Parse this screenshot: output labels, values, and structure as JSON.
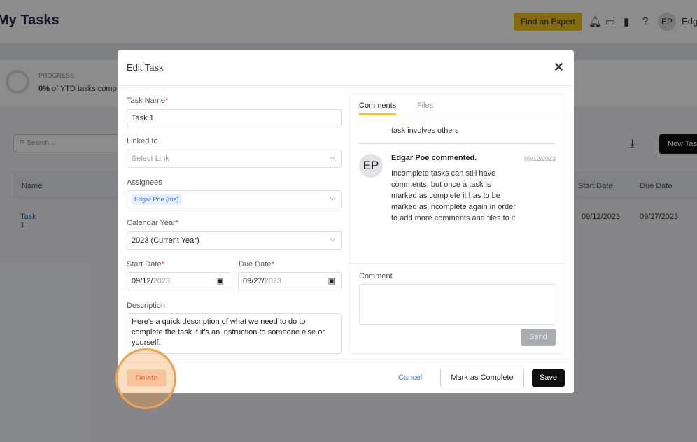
{
  "page": {
    "title": "My Tasks",
    "find_expert": "Find an Expert",
    "avatar": "EP",
    "user": "Edg",
    "progress_label": "PROGRESS",
    "progress_pct": "0%",
    "progress_text": "of YTD tasks comp",
    "search_placeholder": "Search...",
    "new_task": "New Tas",
    "columns": {
      "name": "Name",
      "start": "Start Date",
      "due": "Due Date"
    },
    "row": {
      "name": "Task 1",
      "start": "09/12/2023",
      "due": "09/27/2023"
    }
  },
  "modal": {
    "title": "Edit Task",
    "task_name_label": "Task Name",
    "task_name": "Task 1",
    "linked_label": "Linked to",
    "linked_placeholder": "Select Link",
    "assignees_label": "Assignees",
    "assignee": "Edgar Poe (me)",
    "year_label": "Calendar Year",
    "year": "2023 (Current Year)",
    "start_label": "Start Date",
    "start_md": "09/12/",
    "start_y": "2023",
    "due_label": "Due Date",
    "due_md": "09/27/",
    "due_y": "2023",
    "desc_label": "Description",
    "description": "Here's a quick description of what we need to do to complete the task if it's an instruction to someone else or yourself.",
    "tabs": {
      "comments": "Comments",
      "files": "Files"
    },
    "prev_comment": "task involves others",
    "comment": {
      "avatar": "EP",
      "author": "Edgar Poe commented.",
      "date": "09/12/2023",
      "text": "Incomplete tasks can still have comments, but once a task is marked as complete it has to be marked as incomplete again in order to add more comments and files to it"
    },
    "comment_label": "Comment",
    "send": "Send",
    "delete": "Delete",
    "cancel": "Cancel",
    "mark_complete": "Mark as Complete",
    "save": "Save"
  }
}
